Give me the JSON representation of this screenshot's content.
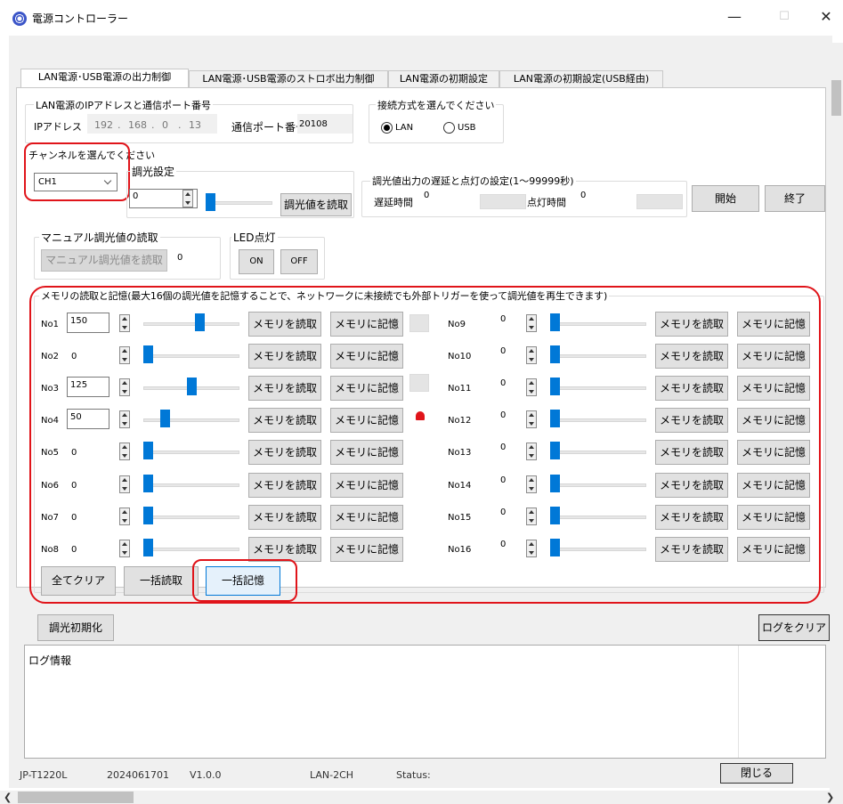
{
  "window": {
    "title": "電源コントローラー",
    "minimize": "—",
    "maximize": "☐",
    "close": "✕"
  },
  "tabs": [
    "LAN電源･USB電源の出力制御",
    "LAN電源･USB電源のストロボ出力制御",
    "LAN電源の初期設定",
    "LAN電源の初期設定(USB経由)"
  ],
  "ip_group": {
    "title": "LAN電源のIPアドレスと通信ポート番号",
    "ip_label": "IPアドレス",
    "ip1": "192",
    "ip2": "168",
    "ip3": "0",
    "ip4": "13",
    "sep": ".",
    "port_label": "通信ポート番号",
    "port": "20108"
  },
  "conn_group": {
    "title": "接続方式を選んでください",
    "lan": "LAN",
    "usb": "USB"
  },
  "channel": {
    "title": "チャンネルを選んでください",
    "value": "CH1"
  },
  "dimming": {
    "title": "調光設定",
    "value": "0",
    "read_button": "調光値を読取"
  },
  "delay": {
    "title": "調光値出力の遅延と点灯の設定(1〜99999秒)",
    "delay_label": "遅延時間",
    "delay_value": "0",
    "on_label": "点灯時間",
    "on_value": "0",
    "start": "開始",
    "stop": "終了"
  },
  "manual": {
    "title": "マニュアル調光値の読取",
    "button": "マニュアル調光値を読取",
    "value": "0"
  },
  "led": {
    "title": "LED点灯",
    "on": "ON",
    "off": "OFF"
  },
  "memory": {
    "title": "メモリの読取と記憶(最大16個の調光値を記憶することで、ネットワークに未接続でも外部トリガーを使って調光値を再生できます)",
    "read": "メモリを読取",
    "save": "メモリに記憶",
    "rows": [
      {
        "label": "No1",
        "value": "150",
        "level": 0.6,
        "boxed": true
      },
      {
        "label": "No2",
        "value": "0",
        "level": 0,
        "boxed": false
      },
      {
        "label": "No3",
        "value": "125",
        "level": 0.5,
        "boxed": true
      },
      {
        "label": "No4",
        "value": "50",
        "level": 0.2,
        "boxed": true
      },
      {
        "label": "No5",
        "value": "0",
        "level": 0,
        "boxed": false
      },
      {
        "label": "No6",
        "value": "0",
        "level": 0,
        "boxed": false
      },
      {
        "label": "No7",
        "value": "0",
        "level": 0,
        "boxed": false
      },
      {
        "label": "No8",
        "value": "0",
        "level": 0,
        "boxed": false
      },
      {
        "label": "No9",
        "value": "0",
        "level": 0,
        "boxed": false
      },
      {
        "label": "No10",
        "value": "0",
        "level": 0,
        "boxed": false
      },
      {
        "label": "No11",
        "value": "0",
        "level": 0,
        "boxed": false
      },
      {
        "label": "No12",
        "value": "0",
        "level": 0,
        "boxed": false
      },
      {
        "label": "No13",
        "value": "0",
        "level": 0,
        "boxed": false
      },
      {
        "label": "No14",
        "value": "0",
        "level": 0,
        "boxed": false
      },
      {
        "label": "No15",
        "value": "0",
        "level": 0,
        "boxed": false
      },
      {
        "label": "No16",
        "value": "0",
        "level": 0,
        "boxed": false
      }
    ],
    "clear_all": "全てクリア",
    "read_all": "一括読取",
    "save_all": "一括記憶"
  },
  "init_button": "調光初期化",
  "clear_log": "ログをクリア",
  "log_label": "ログ情報",
  "status": {
    "model": "JP-T1220L",
    "build": "2024061701",
    "version": "V1.0.0",
    "device": "LAN-2CH",
    "status_label": "Status:",
    "close": "閉じる"
  },
  "colors": {
    "accent": "#0078d7",
    "highlight": "#e0141a"
  }
}
